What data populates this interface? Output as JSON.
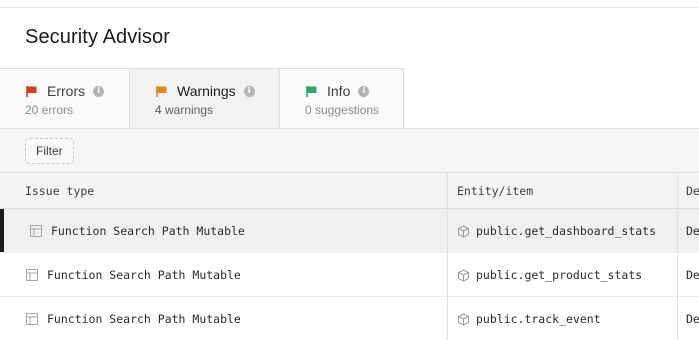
{
  "header": {
    "title": "Security Advisor"
  },
  "tabs": [
    {
      "label": "Errors",
      "sub": "20 errors",
      "icon": "flag-icon",
      "color": "#cf3e22"
    },
    {
      "label": "Warnings",
      "sub": "4 warnings",
      "icon": "flag-icon",
      "color": "#e0861f"
    },
    {
      "label": "Info",
      "sub": "0 suggestions",
      "icon": "flag-icon",
      "color": "#27a86a"
    }
  ],
  "filter": {
    "label": "Filter"
  },
  "table": {
    "columns": [
      "Issue type",
      "Entity/item",
      "De"
    ],
    "rows": [
      {
        "issue": "Function Search Path Mutable",
        "entity": "public.get_dashboard_stats",
        "desc": "De"
      },
      {
        "issue": "Function Search Path Mutable",
        "entity": "public.get_product_stats",
        "desc": "De"
      },
      {
        "issue": "Function Search Path Mutable",
        "entity": "public.track_event",
        "desc": "De"
      }
    ]
  }
}
